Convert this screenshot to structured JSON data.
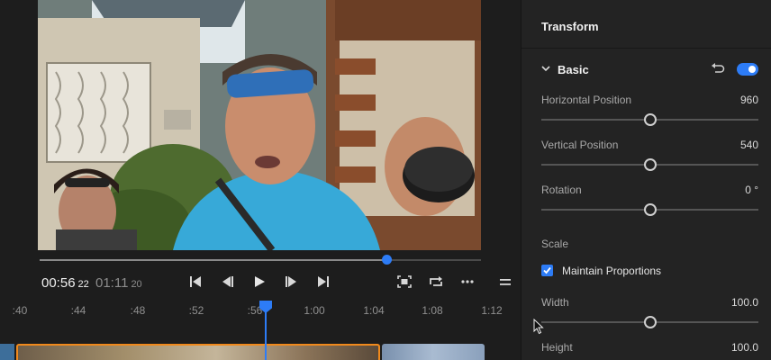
{
  "player": {
    "current_time": "00:56",
    "current_frames": "22",
    "duration_time": "01:11",
    "duration_frames": "20",
    "progress_fraction": 0.786,
    "controls": [
      "go-to-start",
      "step-back",
      "play",
      "step-forward",
      "go-to-end",
      "fit-frame",
      "loop",
      "more",
      "menu"
    ]
  },
  "timeline": {
    "ticks": [
      ":40",
      ":44",
      ":48",
      ":52",
      ":56",
      "1:00",
      "1:04",
      "1:08",
      "1:12"
    ],
    "playhead_label": ":56"
  },
  "panel": {
    "title": "Transform",
    "section": "Basic",
    "section_enabled": true,
    "properties": [
      {
        "label": "Horizontal Position",
        "value": "960",
        "fraction": 0.5
      },
      {
        "label": "Vertical Position",
        "value": "540",
        "fraction": 0.5
      },
      {
        "label": "Rotation",
        "value": "0 °",
        "fraction": 0.5
      }
    ],
    "scale_label": "Scale",
    "maintain_proportions": {
      "label": "Maintain Proportions",
      "checked": true
    },
    "scale_properties": [
      {
        "label": "Width",
        "value": "100.0",
        "fraction": 0.5
      },
      {
        "label": "Height",
        "value": "100.0",
        "fraction": 0.5
      }
    ]
  },
  "colors": {
    "accent": "#2d7cf6",
    "clip_selected": "#f0891c",
    "panel_bg": "#232323",
    "app_bg": "#1d1d1d"
  }
}
